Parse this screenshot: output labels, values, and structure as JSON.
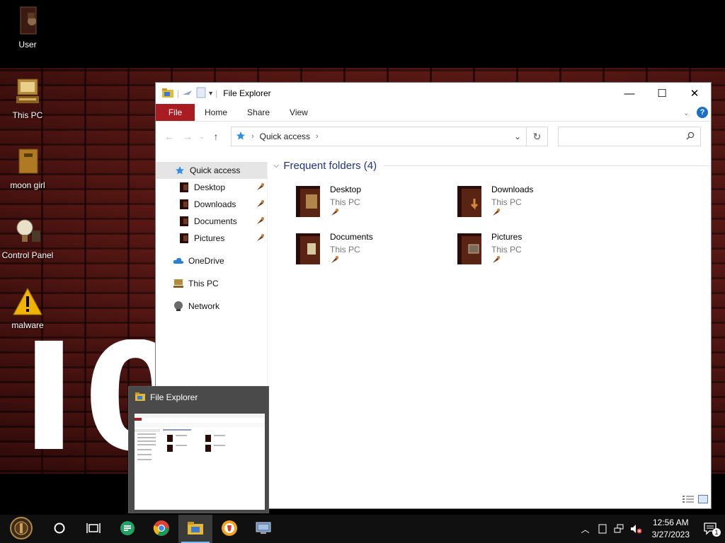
{
  "desktop": {
    "icons": [
      {
        "label": "User",
        "icon": "user-icon"
      },
      {
        "label": "This PC",
        "icon": "computer-icon"
      },
      {
        "label": "moon girl",
        "icon": "box-icon"
      },
      {
        "label": "Control Panel",
        "icon": "lightbulb-icon"
      },
      {
        "label": "malware",
        "icon": "warning-icon"
      }
    ]
  },
  "explorer": {
    "title": "File Explorer",
    "ribbon_tabs": [
      "File",
      "Home",
      "Share",
      "View"
    ],
    "address": {
      "path_label": "Quick access"
    },
    "search": {
      "placeholder": ""
    },
    "nav": {
      "quick_access": "Quick access",
      "pinned": [
        "Desktop",
        "Downloads",
        "Documents",
        "Pictures"
      ],
      "onedrive": "OneDrive",
      "this_pc": "This PC",
      "network": "Network"
    },
    "group_title": "Frequent folders (4)",
    "folders": [
      {
        "name": "Desktop",
        "location": "This PC"
      },
      {
        "name": "Downloads",
        "location": "This PC"
      },
      {
        "name": "Documents",
        "location": "This PC"
      },
      {
        "name": "Pictures",
        "location": "This PC"
      }
    ]
  },
  "preview": {
    "title": "File Explorer"
  },
  "taskbar": {
    "apps": [
      "start-icon",
      "cortana-icon",
      "task-view-icon",
      "sheets-icon",
      "chrome-icon",
      "file-explorer-icon",
      "brave-icon",
      "remote-desktop-icon"
    ]
  },
  "clock": {
    "time": "12:56 AM",
    "date": "3/27/2023"
  },
  "notifications": {
    "count": "1"
  },
  "colors": {
    "file_tab": "#a91d22",
    "group_header": "#1e3287",
    "help": "#1a6fc9"
  }
}
